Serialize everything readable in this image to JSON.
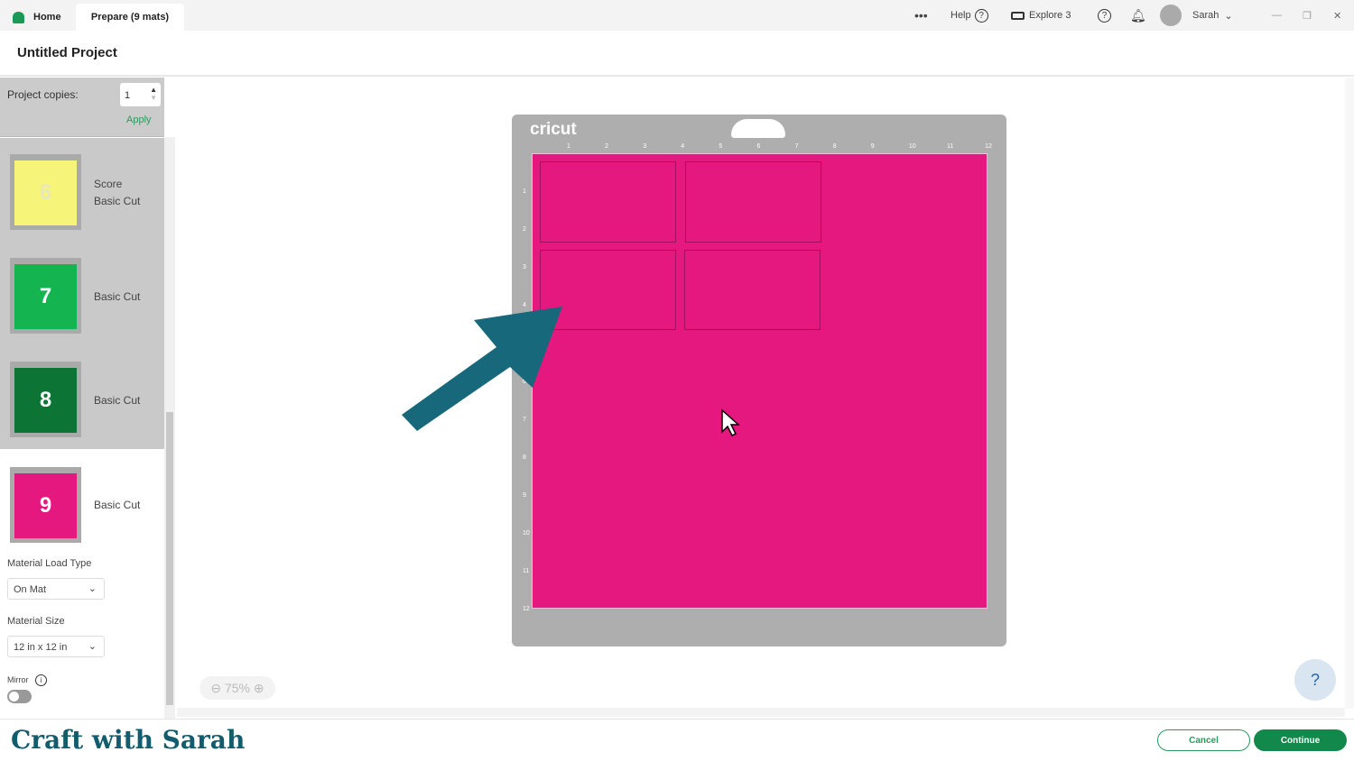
{
  "tabs": {
    "home": "Home",
    "prepare": "Prepare (9 mats)"
  },
  "top": {
    "more": "•••",
    "help": "Help",
    "machine": "Explore 3",
    "user": "Sarah"
  },
  "project_title": "Untitled Project",
  "copies": {
    "label": "Project copies:",
    "value": "1",
    "apply": "Apply"
  },
  "mats": [
    {
      "number": "6",
      "color": "#f6f57a",
      "lines": [
        "Score",
        "Basic Cut"
      ]
    },
    {
      "number": "7",
      "color": "#14b450",
      "lines": [
        "Basic Cut"
      ]
    },
    {
      "number": "8",
      "color": "#0c7434",
      "lines": [
        "Basic Cut"
      ]
    },
    {
      "number": "9",
      "color": "#e5187f",
      "lines": [
        "Basic Cut"
      ]
    }
  ],
  "material_load": {
    "label": "Material Load Type",
    "value": "On Mat"
  },
  "material_size": {
    "label": "Material Size",
    "value": "12 in x 12 in"
  },
  "mirror": {
    "label": "Mirror",
    "on": false
  },
  "canvas": {
    "brand": "cricut",
    "ruler": [
      "1",
      "2",
      "3",
      "4",
      "5",
      "6",
      "7",
      "8",
      "9",
      "10",
      "11",
      "12"
    ],
    "zoom": "75%",
    "mat_color": "#e5187f"
  },
  "footer": {
    "logo": "Craft with Sarah",
    "cancel": "Cancel",
    "continue": "Continue"
  }
}
